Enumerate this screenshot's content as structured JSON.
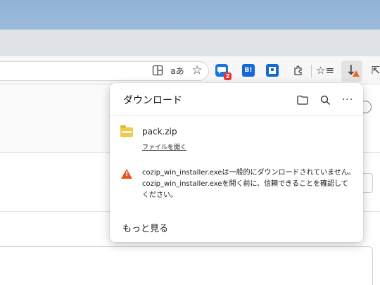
{
  "toolbar": {
    "split_icon": "split-screen-icon",
    "read_aloud_glyph": "aあ",
    "favorite_glyph": "☆",
    "extensions": [
      {
        "name": "chat-extension",
        "badge": "2",
        "color": "#1a73e8"
      },
      {
        "name": "hatena-bookmark-extension",
        "label": "B!",
        "color": "#1769d6"
      },
      {
        "name": "pocket-extension",
        "color": "#1769d6"
      }
    ],
    "puzzle_icon": "extensions-icon",
    "favorites_glyph": "☆≡",
    "download_glyph": "↓",
    "share_glyph": "⇱"
  },
  "downloads": {
    "title": "ダウンロード",
    "actions": {
      "folder_icon": "folder-icon",
      "search_glyph": "⌕",
      "more_glyph": "···"
    },
    "items": [
      {
        "file_name": "pack.zip",
        "link": "ファイルを開く"
      }
    ],
    "warning": {
      "line1": "cozip_win_installer.exeは一般的にダウンロードされていません。",
      "line2": "cozip_win_installer.exeを開く前に、信頼できることを確認して",
      "line3": "ください。"
    },
    "see_more": "もっと見る"
  },
  "colors": {
    "warning": "#e8561a",
    "accent": "#1769d6",
    "zip": "#f2c94c"
  }
}
